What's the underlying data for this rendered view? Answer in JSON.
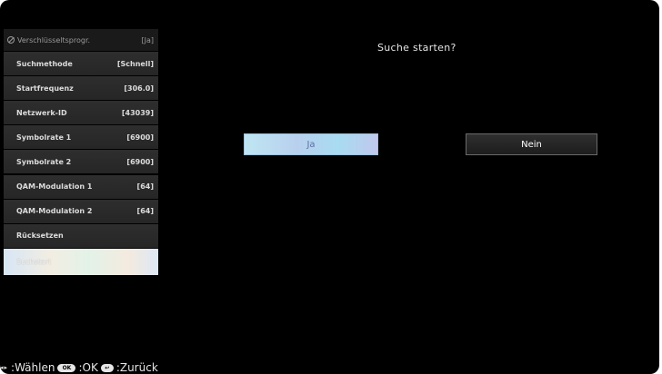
{
  "menu": {
    "items": [
      {
        "label": "Verschlüsseltsprogr.",
        "value": "[Ja]"
      },
      {
        "label": "Suchmethode",
        "value": "[Schnell]"
      },
      {
        "label": "Startfrequenz",
        "value": "[306.0]"
      },
      {
        "label": "Netzwerk-ID",
        "value": "[43039]"
      },
      {
        "label": "Symbolrate 1",
        "value": "[6900]"
      },
      {
        "label": "Symbolrate 2",
        "value": "[6900]"
      },
      {
        "label": "QAM-Modulation 1",
        "value": "[64]"
      },
      {
        "label": "QAM-Modulation 2",
        "value": "[64]"
      },
      {
        "label": "Rücksetzen",
        "value": ""
      },
      {
        "label": "Suchstart",
        "value": ""
      }
    ]
  },
  "dialog": {
    "question": "Suche starten?",
    "yes_label": "Ja",
    "no_label": "Nein"
  },
  "footer": {
    "select_text": ":Wählen",
    "ok_icon_text": "OK",
    "ok_text": ":OK",
    "back_text": ":Zurück"
  },
  "icons": {
    "lock": "lock-icon",
    "arrows": "left-right-arrows-icon",
    "ok": "ok-button-icon",
    "back": "return-button-icon"
  },
  "colors": {
    "background": "#000000",
    "menu_item": "#2a2a2a",
    "selected_item": "#e4ecef",
    "yes_button": "#b8d6ee",
    "no_button": "#262626"
  }
}
